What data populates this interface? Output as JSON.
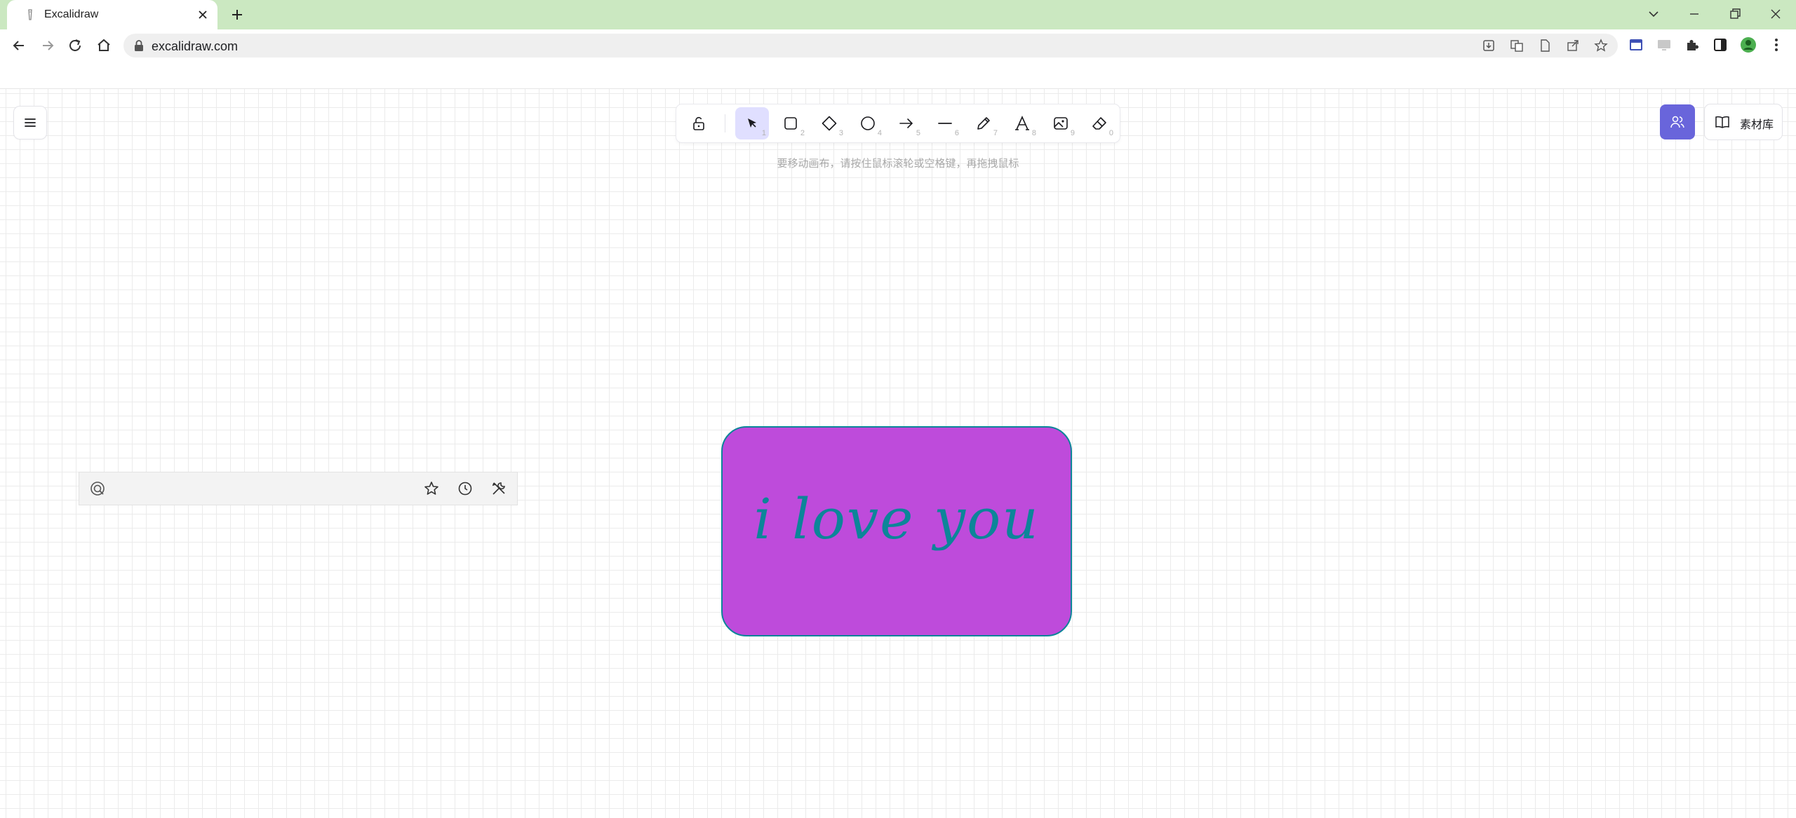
{
  "browser": {
    "tab_title": "Excalidraw",
    "url": "excalidraw.com"
  },
  "toolbar": {
    "tools": [
      {
        "name": "selection",
        "key": "1"
      },
      {
        "name": "rectangle",
        "key": "2"
      },
      {
        "name": "diamond",
        "key": "3"
      },
      {
        "name": "ellipse",
        "key": "4"
      },
      {
        "name": "arrow",
        "key": "5"
      },
      {
        "name": "line",
        "key": "6"
      },
      {
        "name": "draw",
        "key": "7"
      },
      {
        "name": "text",
        "key": "8"
      },
      {
        "name": "image",
        "key": "9"
      },
      {
        "name": "eraser",
        "key": "0"
      }
    ],
    "active_tool": "selection",
    "hint": "要移动画布，请按住鼠标滚轮或空格键，再拖拽鼠标"
  },
  "top_right": {
    "library_label": "素材库"
  },
  "canvas": {
    "element_text": "i love you",
    "element_fill": "#be4bdb",
    "element_stroke": "#0c8599"
  },
  "colors": {
    "accent": "#6965db",
    "active_tool_bg": "#e0dfff",
    "tab_strip": "#cbe8c1"
  }
}
